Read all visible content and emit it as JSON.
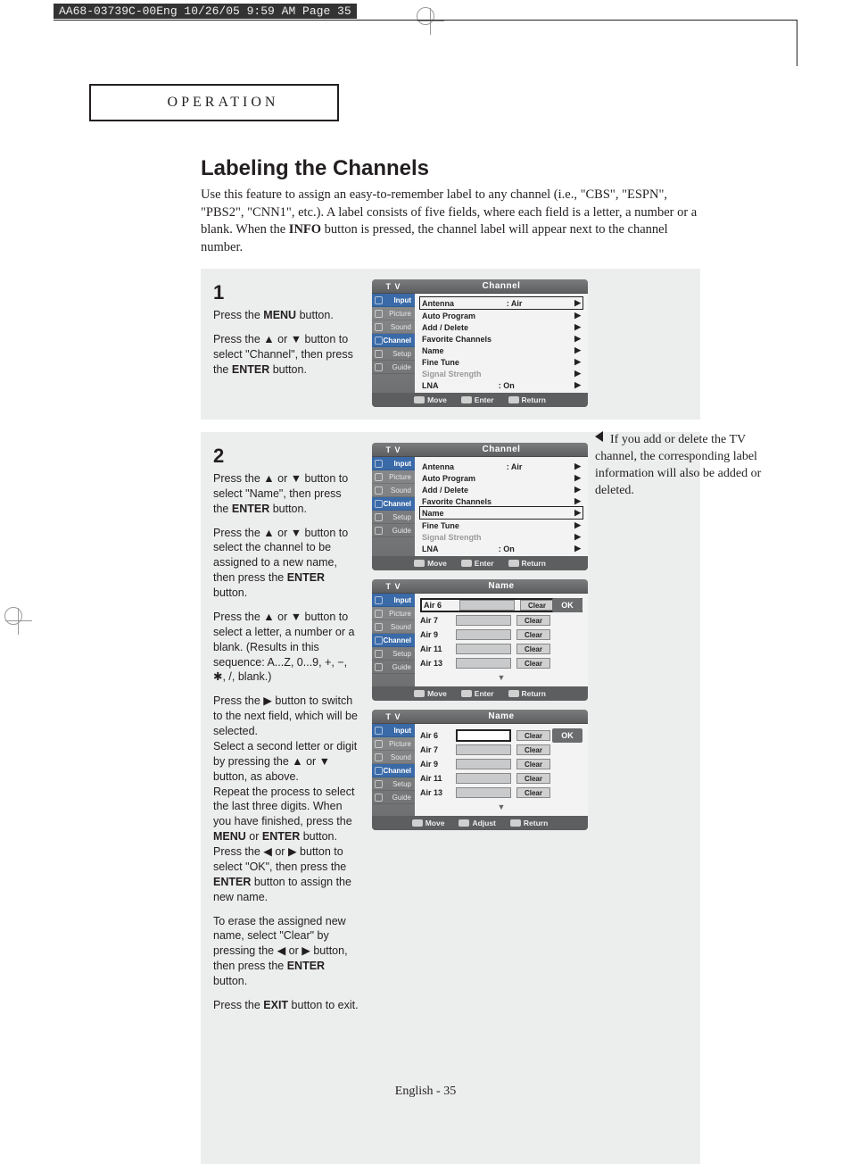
{
  "print_header": "AA68-03739C-00Eng  10/26/05  9:59 AM  Page 35",
  "section_label": "OPERATION",
  "page_title": "Labeling the Channels",
  "intro_parts": {
    "p1": "Use this feature to assign an easy-to-remember label to any channel (i.e., \"CBS\", \"ESPN\", \"PBS2\", \"CNN1\", etc.). A label consists of five fields, where each field is a letter, a number or a blank. When the ",
    "bold": "INFO",
    "p2": " button is pressed, the channel label will appear next to the channel number."
  },
  "steps": {
    "s1": {
      "num": "1",
      "line1a": "Press the ",
      "line1b": "MENU",
      "line1c": " button.",
      "line2a": "Press the ▲ or ▼ button to select \"Channel\", then press the ",
      "line2b": "ENTER",
      "line2c": " button."
    },
    "s2": {
      "num": "2",
      "p1a": "Press the ▲ or ▼ button to select \"Name\", then press the ",
      "p1b": "ENTER",
      "p1c": " button.",
      "p2a": "Press the ▲ or ▼ button to select the channel to be assigned to a new name, then press the ",
      "p2b": "ENTER",
      "p2c": " button.",
      "p3": "Press the ▲ or ▼ button to select a letter, a number or a blank. (Results in this sequence: A...Z, 0...9, +, −, ✱, /, blank.)",
      "p4a": "Press the ▶ button to switch to the next field, which will be selected.",
      "p4b": "Select a second letter or digit by pressing the ▲ or ▼ button, as above.",
      "p4c": "Repeat the process to select the last three digits. When you have finished, press the ",
      "p4d": "MENU",
      "p4e": " or ",
      "p4f": "ENTER",
      "p4g": " button. Press the ◀ or ▶ button to select \"OK\", then press the ",
      "p4h": "ENTER",
      "p4i": " button to assign the new name.",
      "p5a": "To erase the assigned new name, select \"Clear\" by pressing the ◀ or ▶ button, then press the ",
      "p5b": "ENTER",
      "p5c": " button.",
      "p6a": "Press the ",
      "p6b": "EXIT",
      "p6c": " button to exit."
    }
  },
  "osd": {
    "tv": "T V",
    "title_channel": "Channel",
    "title_name": "Name",
    "side_items": [
      "Input",
      "Picture",
      "Sound",
      "Channel",
      "Setup",
      "Guide"
    ],
    "channel_rows": {
      "antenna_label": "Antenna",
      "antenna_value": ":   Air",
      "auto_program": "Auto Program",
      "add_delete": "Add / Delete",
      "favorite": "Favorite Channels",
      "name": "Name",
      "fine_tune": "Fine Tune",
      "signal": "Signal Strength",
      "lna_label": "LNA",
      "lna_value": ":   On"
    },
    "footer": {
      "move": "Move",
      "enter": "Enter",
      "return": "Return",
      "adjust": "Adjust"
    },
    "name_rows": [
      "Air 6",
      "Air 7",
      "Air 9",
      "Air 11",
      "Air 13"
    ],
    "clear": "Clear",
    "ok": "OK",
    "scroll": "▼"
  },
  "side_note": "If you add or delete the TV channel, the corresponding label information will also be added or deleted.",
  "page_footer": "English - 35"
}
